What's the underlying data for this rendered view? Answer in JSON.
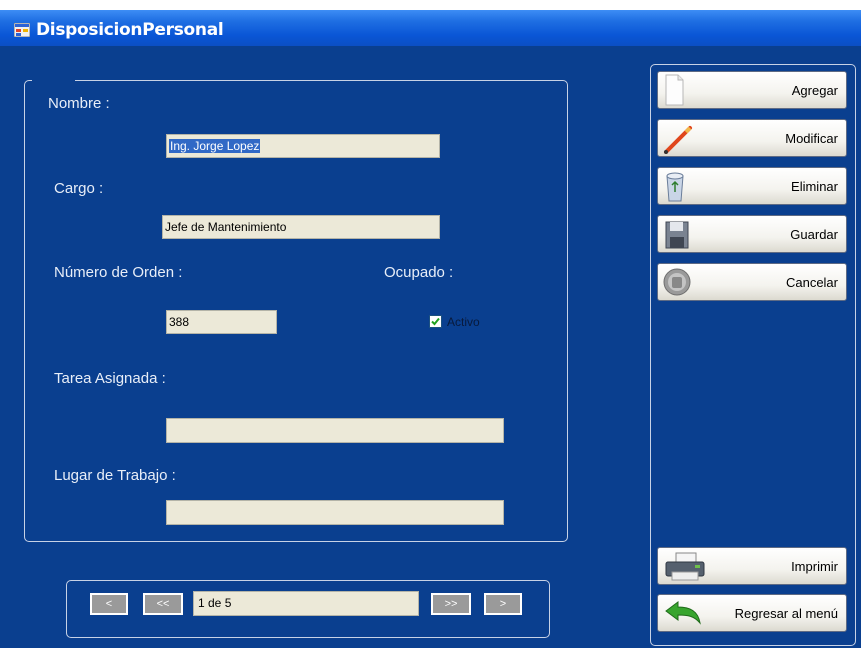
{
  "window": {
    "title": "DisposicionPersonal"
  },
  "form": {
    "nombre_label": "Nombre :",
    "nombre_value": "Ing. Jorge Lopez",
    "cargo_label": "Cargo :",
    "cargo_value": "Jefe de Mantenimiento",
    "numero_label": "Número de Orden :",
    "numero_value": "388",
    "ocupado_label": "Ocupado :",
    "activo_label": "Activo",
    "activo_checked": true,
    "tarea_label": "Tarea Asignada :",
    "tarea_value": "",
    "lugar_label": "Lugar de Trabajo :",
    "lugar_value": ""
  },
  "actions": {
    "agregar": "Agregar",
    "modificar": "Modificar",
    "eliminar": "Eliminar",
    "guardar": "Guardar",
    "cancelar": "Cancelar",
    "imprimir": "Imprimir",
    "regresar": "Regresar al menú"
  },
  "nav": {
    "prev": "<",
    "first": "<<",
    "position": "1 de 5",
    "last": ">>",
    "next": ">"
  },
  "icons": {
    "agregar": "new-document-icon",
    "modificar": "pencil-icon",
    "eliminar": "recycle-bin-icon",
    "guardar": "floppy-disk-icon",
    "cancelar": "stop-hand-icon",
    "imprimir": "printer-icon",
    "regresar": "back-arrow-icon"
  },
  "colors": {
    "background": "#0a3f8f",
    "titlebar": "#0a56d6"
  }
}
